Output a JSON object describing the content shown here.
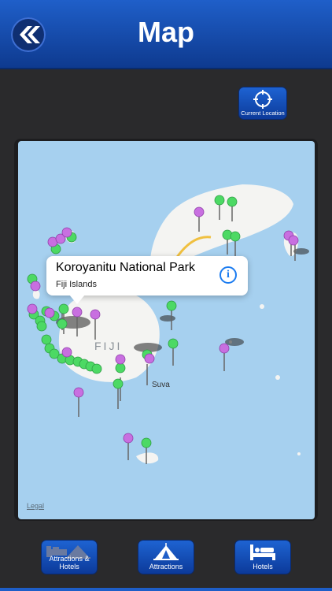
{
  "header": {
    "title": "Map",
    "back_icon": "double-chevron-left-icon"
  },
  "toolbar": {
    "current_location_label": "Current Location",
    "current_location_icon": "crosshair-icon"
  },
  "map": {
    "island_label": "FIJI",
    "city_label": "Suva",
    "legal_label": "Legal",
    "pin_colors": {
      "green": "#4cd964",
      "purple": "#c86fe0"
    }
  },
  "callout": {
    "title": "Koroyanitu National Park",
    "subtitle": "Fiji Islands",
    "info_icon": "info-icon",
    "info_glyph": "i"
  },
  "nav": {
    "attractions_hotels_label": "Attractions & Hotels",
    "attractions_label": "Attractions",
    "hotels_label": "Hotels"
  },
  "colors": {
    "header": "#1f5fc9",
    "button": "#1e63d2",
    "water": "#a6d0ef",
    "land": "#f4f4f2"
  }
}
